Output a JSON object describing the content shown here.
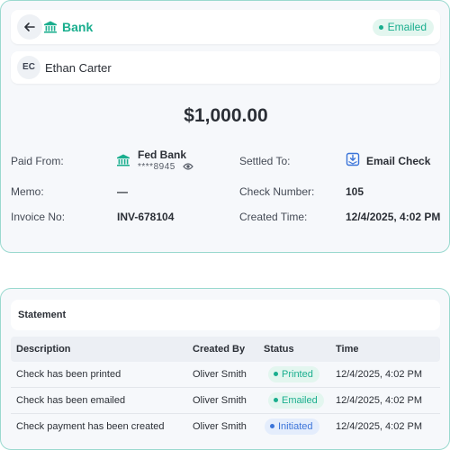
{
  "header": {
    "title": "Bank",
    "status_badge": "Emailed",
    "back_icon": "arrow-left-icon",
    "bank_icon": "bank-icon"
  },
  "customer": {
    "initials": "EC",
    "name": "Ethan Carter"
  },
  "payment": {
    "amount": "$1,000.00",
    "paid_from_label": "Paid From:",
    "paid_from_bank": "Fed Bank",
    "paid_from_account": "****8945",
    "settled_to_label": "Settled To:",
    "settled_to_value": "Email Check",
    "memo_label": "Memo:",
    "memo_value": "—",
    "check_number_label": "Check Number:",
    "check_number_value": "105",
    "invoice_label": "Invoice No:",
    "invoice_value": "INV-678104",
    "created_time_label": "Created Time:",
    "created_time_value": "12/4/2025, 4:02 PM"
  },
  "statement": {
    "title": "Statement",
    "columns": [
      "Description",
      "Created By",
      "Status",
      "Time"
    ],
    "rows": [
      {
        "description": "Check has been printed",
        "created_by": "Oliver Smith",
        "status": "Printed",
        "time": "12/4/2025, 4:02 PM"
      },
      {
        "description": "Check has been emailed",
        "created_by": "Oliver Smith",
        "status": "Emailed",
        "time": "12/4/2025, 4:02 PM"
      },
      {
        "description": "Check payment has been created",
        "created_by": "Oliver Smith",
        "status": "Initiated",
        "time": "12/4/2025, 4:02 PM"
      }
    ]
  },
  "colors": {
    "accent": "#1aae8e",
    "border": "#9ad9cf",
    "initiated": "#3b74d9"
  }
}
